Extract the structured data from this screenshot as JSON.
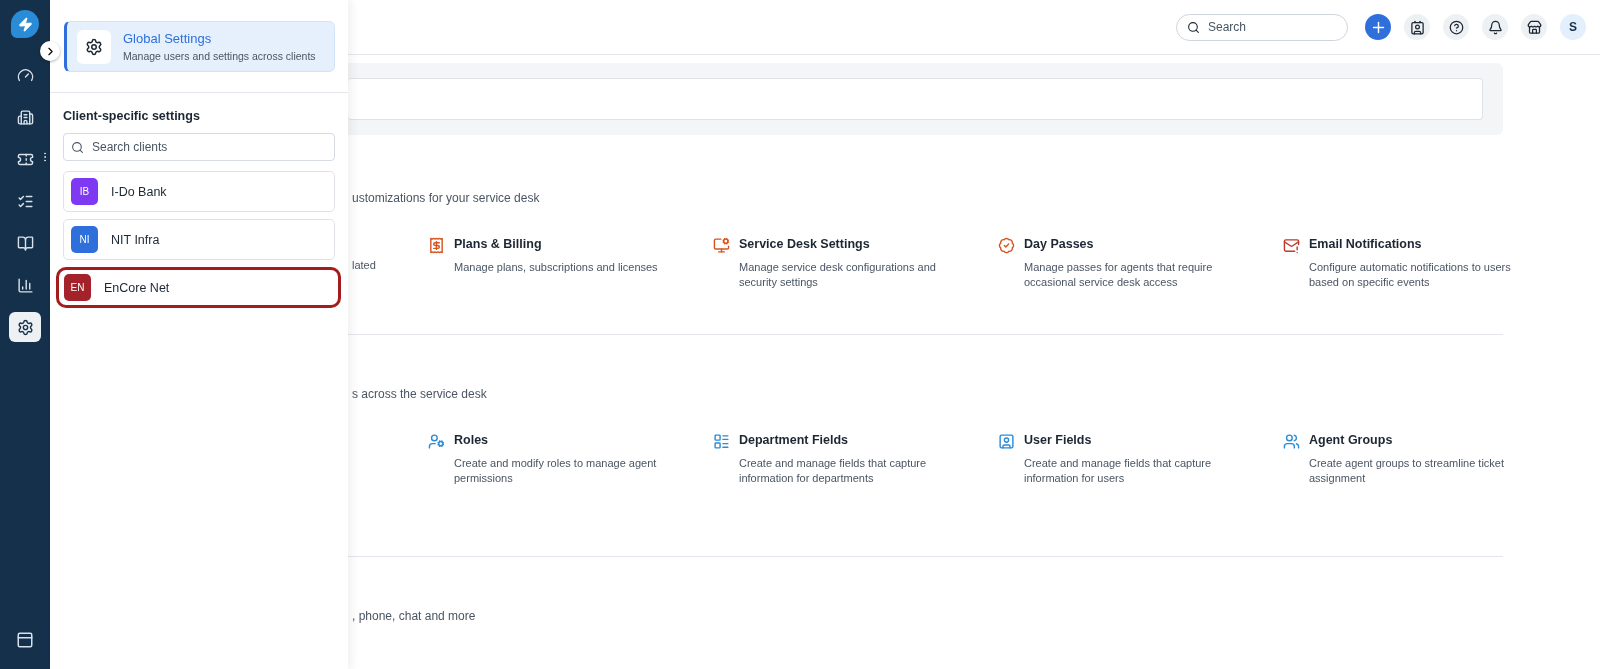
{
  "rail": {
    "items": [
      {
        "kind": "dashboard",
        "selected": false
      },
      {
        "kind": "building",
        "selected": false
      },
      {
        "kind": "ticket",
        "selected": false
      },
      {
        "kind": "tasks",
        "selected": false
      },
      {
        "kind": "book",
        "selected": false
      },
      {
        "kind": "chart",
        "selected": false
      },
      {
        "kind": "settings",
        "selected": true
      }
    ]
  },
  "flyout": {
    "global": {
      "title": "Global Settings",
      "description": "Manage users and settings across clients",
      "selected": true
    },
    "section_title": "Client-specific settings",
    "search": {
      "placeholder": "Search clients"
    },
    "clients": [
      {
        "initials": "IB",
        "name": "I-Do Bank",
        "color": "#7e3af2",
        "selected": false
      },
      {
        "initials": "NI",
        "name": "NIT Infra",
        "color": "#2f6fdb",
        "selected": false
      },
      {
        "initials": "EN",
        "name": "EnCore Net",
        "color": "#a4232a",
        "selected": true
      }
    ]
  },
  "topbar": {
    "search": {
      "placeholder": "Search"
    },
    "avatar": "S"
  },
  "sections": [
    {
      "subtitle": "ustomizations for your service desk",
      "partial_text": "lated",
      "cards": [
        {
          "title": "Plans & Billing",
          "description": "Manage plans, subscriptions and licenses"
        },
        {
          "title": "Service Desk Settings",
          "description": "Manage service desk configurations and security settings"
        },
        {
          "title": "Day Passes",
          "description": "Manage passes for agents that require occasional service desk access"
        },
        {
          "title": "Email Notifications",
          "description": "Configure automatic notifications to users based on specific events"
        }
      ]
    },
    {
      "subtitle": "s across the service desk",
      "cards": [
        {
          "title": "Roles",
          "description": "Create and modify roles to manage agent permissions"
        },
        {
          "title": "Department Fields",
          "description": "Create and manage fields that capture information for departments"
        },
        {
          "title": "User Fields",
          "description": "Create and manage fields that capture information for users"
        },
        {
          "title": "Agent Groups",
          "description": "Create agent groups to streamline ticket assignment"
        }
      ]
    },
    {
      "subtitle": ", phone, chat and more"
    }
  ]
}
